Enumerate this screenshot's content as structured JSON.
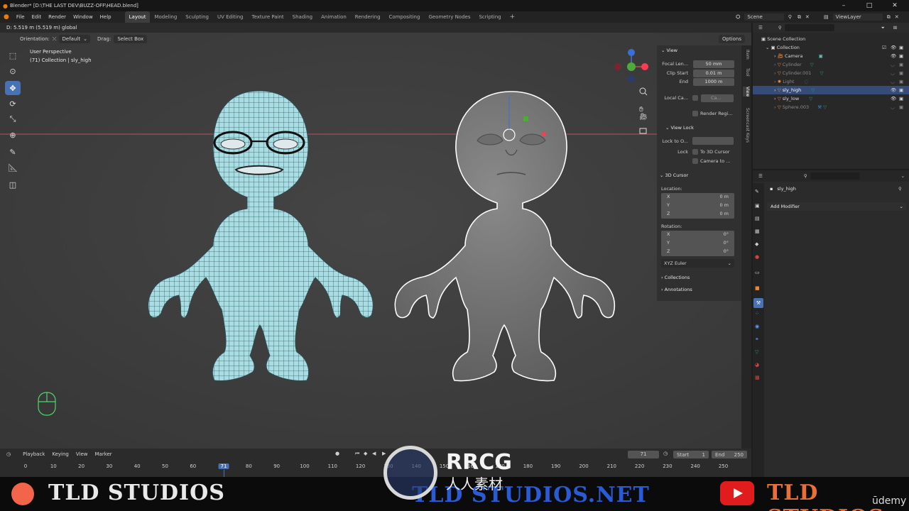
{
  "window": {
    "title": "Blender* [D:\\THE LAST DEV\\BUZZ-OFF\\HEAD.blend]"
  },
  "menu": [
    "File",
    "Edit",
    "Render",
    "Window",
    "Help"
  ],
  "workspaces": [
    "Layout",
    "Modeling",
    "Sculpting",
    "UV Editing",
    "Texture Paint",
    "Shading",
    "Animation",
    "Rendering",
    "Compositing",
    "Geometry Nodes",
    "Scripting"
  ],
  "scene": {
    "label": "Scene",
    "view_layer": "ViewLayer"
  },
  "header": {
    "status": "D: 5.519 m (5.519 m) global",
    "orientation_label": "Orientation:",
    "orientation_value": "Default",
    "drag_label": "Drag:",
    "drag_value": "Select Box",
    "options": "Options"
  },
  "viewport": {
    "perspective": "User Perspective",
    "collection_info": "(71) Collection | sly_high"
  },
  "npanel": {
    "view_title": "View",
    "focal_label": "Focal Len...",
    "focal_value": "50 mm",
    "clip_start_label": "Clip Start",
    "clip_start_value": "0.01 m",
    "end_label": "End",
    "end_value": "1000 m",
    "local_camera_label": "Local Ca...",
    "local_camera_value": "Ca...",
    "render_region": "Render Regi...",
    "view_lock_title": "View Lock",
    "lock_to_object": "Lock to O...",
    "lock_label": "Lock",
    "to_3d_cursor": "To 3D Cursor",
    "camera_to": "Camera to ...",
    "cursor_title": "3D Cursor",
    "location_label": "Location:",
    "loc_x_label": "X",
    "loc_x": "0 m",
    "loc_y_label": "Y",
    "loc_y": "0 m",
    "loc_z_label": "Z",
    "loc_z": "0 m",
    "rotation_label": "Rotation:",
    "rot_x_label": "X",
    "rot_x": "0°",
    "rot_y_label": "Y",
    "rot_y": "0°",
    "rot_z_label": "Z",
    "rot_z": "0°",
    "rotation_mode": "XYZ Euler",
    "collections": "Collections",
    "annotations": "Annotations",
    "tabs": [
      "Item",
      "Tool",
      "View",
      "Screencast Keys"
    ]
  },
  "outliner": {
    "root": "Scene Collection",
    "collection": "Collection",
    "items": [
      "Camera",
      "Cylinder",
      "Cylinder.001",
      "Light",
      "sly_high",
      "sly_low",
      "Sphere.003"
    ]
  },
  "properties": {
    "object_name": "sly_high",
    "add_modifier": "Add Modifier"
  },
  "timeline": {
    "menus": [
      "Playback",
      "Keying",
      "View",
      "Marker"
    ],
    "current_frame": "71",
    "start_label": "Start",
    "start_value": "1",
    "end_label": "End",
    "end_value": "250",
    "ticks": [
      "0",
      "10",
      "20",
      "30",
      "40",
      "50",
      "60",
      "71",
      "80",
      "90",
      "100",
      "110",
      "120",
      "130",
      "140",
      "150",
      "160",
      "170",
      "180",
      "190",
      "200",
      "210",
      "220",
      "230",
      "240",
      "250"
    ]
  },
  "watermark": {
    "left_brand": "TLD STUDIOS",
    "center_brand": "TLD STUDIOS.NET",
    "rrcg": "RRCG",
    "rrcg_sub": "人人素材",
    "right_brand": "TLD STUDIOS",
    "udemy": "ūdemy"
  },
  "colors": {
    "accent": "#4772b3",
    "wireframe": "#9fd8e0",
    "mesh_gray": "#7a7a7a",
    "selection_outline": "#ffffff",
    "timeline_marker": "#4772b3"
  }
}
